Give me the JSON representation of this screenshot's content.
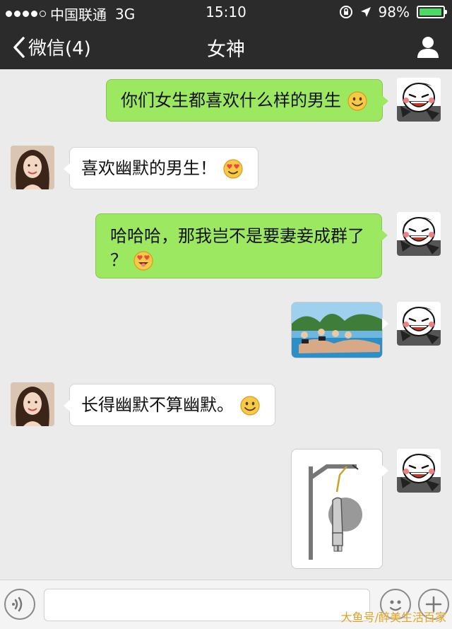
{
  "status_bar": {
    "carrier": "中国联通",
    "network": "3G",
    "time": "15:10",
    "battery": "98%",
    "battery_level": 0.98
  },
  "nav": {
    "back_label": "微信(4)",
    "title": "女神"
  },
  "messages": [
    {
      "direction": "out",
      "type": "text",
      "text": "你们女生都喜欢什么样的男生",
      "emoji": "smile"
    },
    {
      "direction": "in",
      "type": "text",
      "text": "喜欢幽默的男生！",
      "emoji": "heart-eyes"
    },
    {
      "direction": "out",
      "type": "text",
      "text": "哈哈哈，那我岂不是要妻妾成群了",
      "text2": "？",
      "emoji": "heart-eyes-tongue"
    },
    {
      "direction": "out",
      "type": "image",
      "image": "pool-photo"
    },
    {
      "direction": "in",
      "type": "text",
      "text": "长得幽默不算幽默。",
      "emoji": "smile"
    },
    {
      "direction": "out",
      "type": "sticker",
      "image": "hanging-sticker"
    }
  ],
  "watermark": "大鱼号/醉美生活百家",
  "colors": {
    "header_bg": "#2b2b2b",
    "chat_bg": "#ebebeb",
    "outgoing_bubble": "#9de861",
    "incoming_bubble": "#ffffff"
  }
}
